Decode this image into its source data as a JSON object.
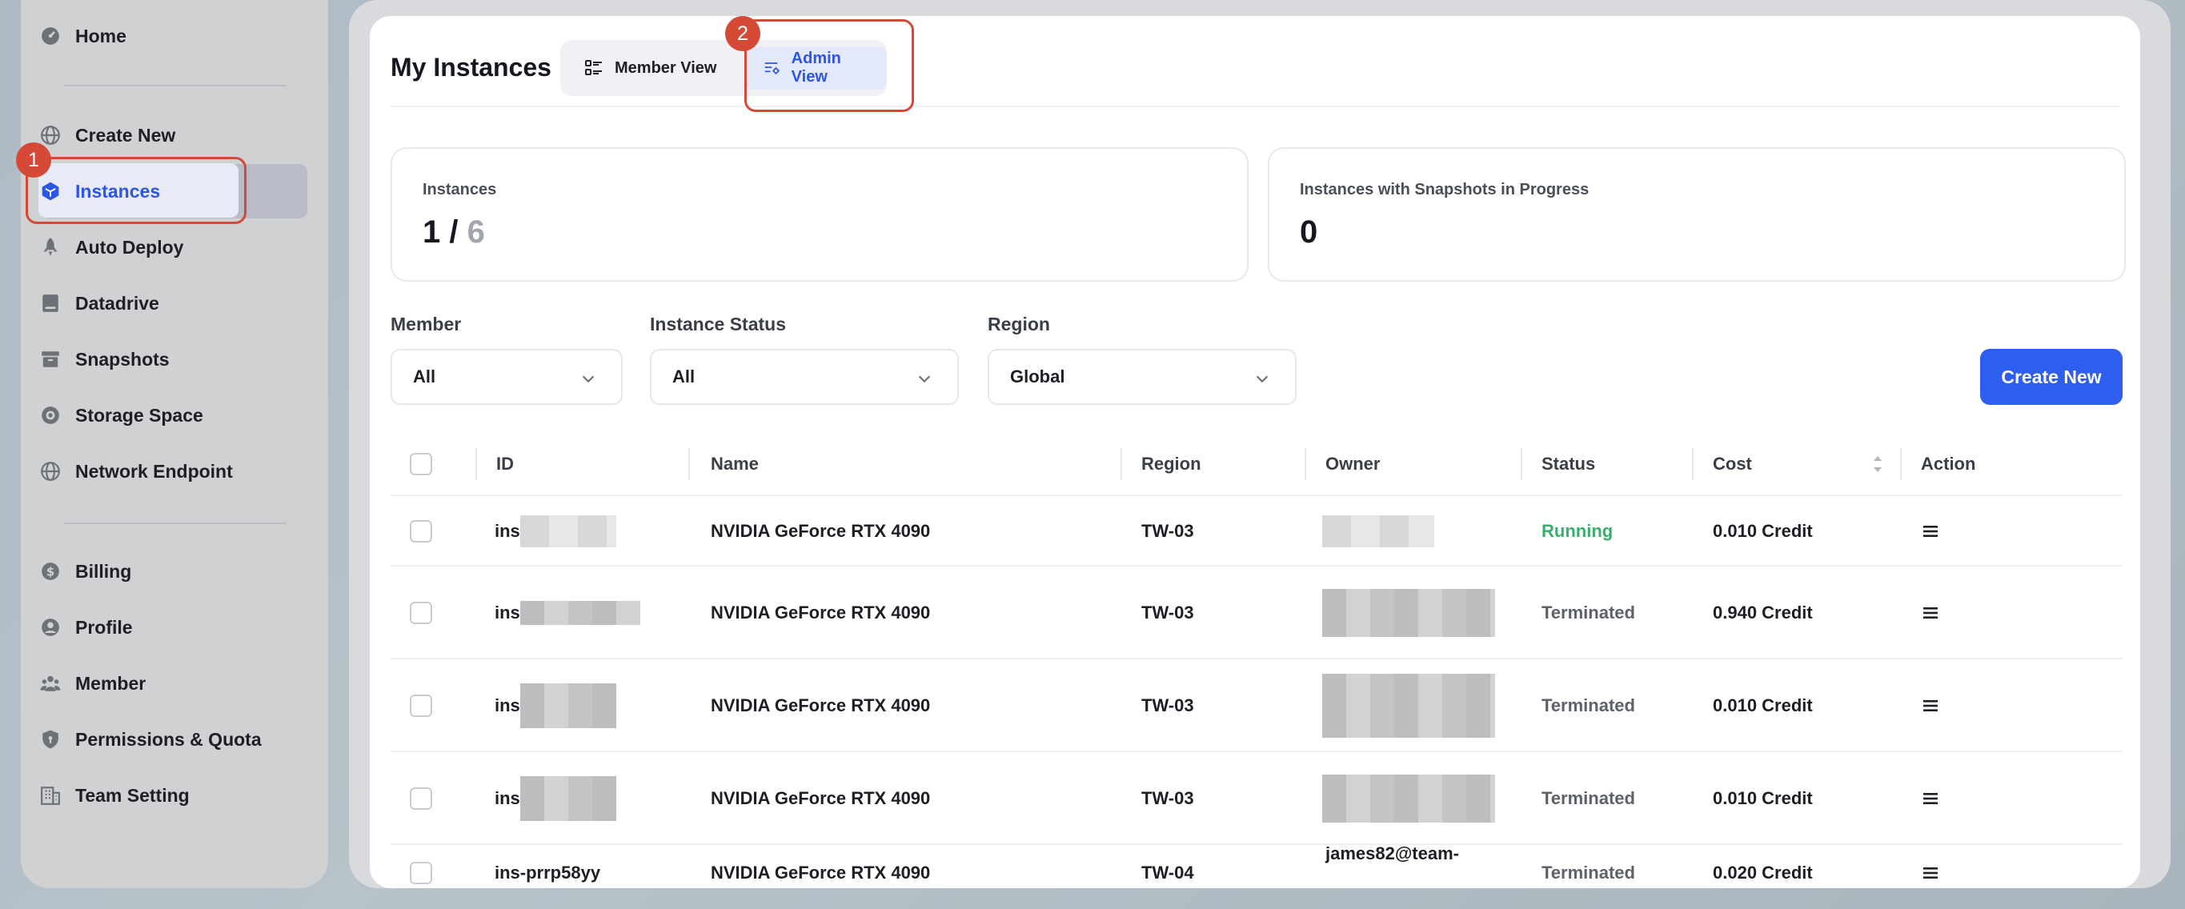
{
  "sidebar": {
    "items": [
      {
        "label": "Home",
        "icon": "dashboard-gauge-icon"
      },
      {
        "label": "Create New",
        "icon": "globe-icon"
      },
      {
        "label": "Instances",
        "icon": "cube-icon",
        "active": true
      },
      {
        "label": "Auto Deploy",
        "icon": "rocket-icon"
      },
      {
        "label": "Datadrive",
        "icon": "drive-icon"
      },
      {
        "label": "Snapshots",
        "icon": "archive-box-icon"
      },
      {
        "label": "Storage Space",
        "icon": "storage-disk-icon"
      },
      {
        "label": "Network Endpoint",
        "icon": "network-globe-icon"
      },
      {
        "label": "Billing",
        "icon": "coin-icon"
      },
      {
        "label": "Profile",
        "icon": "user-circle-icon"
      },
      {
        "label": "Member",
        "icon": "users-icon"
      },
      {
        "label": "Permissions & Quota",
        "icon": "shield-icon"
      },
      {
        "label": "Team Setting",
        "icon": "building-icon"
      }
    ]
  },
  "annotations": {
    "badge1": "1",
    "badge2": "2"
  },
  "header": {
    "title": "My Instances",
    "tabs": [
      {
        "label": "Member View",
        "icon": "list-icon"
      },
      {
        "label": "Admin View",
        "icon": "list-settings-icon",
        "selected": true
      }
    ]
  },
  "stats": [
    {
      "label": "Instances",
      "value": "1 /",
      "total": "6"
    },
    {
      "label": "Instances with Snapshots in Progress",
      "value": "0"
    }
  ],
  "filters": {
    "member": {
      "label": "Member",
      "value": "All"
    },
    "status": {
      "label": "Instance Status",
      "value": "All"
    },
    "region": {
      "label": "Region",
      "value": "Global"
    },
    "create_label": "Create New"
  },
  "table": {
    "columns": [
      "ID",
      "Name",
      "Region",
      "Owner",
      "Status",
      "Cost",
      "Action"
    ],
    "rows": [
      {
        "id": "ins",
        "name": "NVIDIA GeForce RTX 4090",
        "region": "TW-03",
        "owner": "",
        "status": "Running",
        "cost": "0.010 Credit"
      },
      {
        "id": "ins",
        "name": "NVIDIA GeForce RTX 4090",
        "region": "TW-03",
        "owner": "",
        "status": "Terminated",
        "cost": "0.940 Credit"
      },
      {
        "id": "ins",
        "name": "NVIDIA GeForce RTX 4090",
        "region": "TW-03",
        "owner": "",
        "status": "Terminated",
        "cost": "0.010 Credit"
      },
      {
        "id": "ins",
        "name": "NVIDIA GeForce RTX 4090",
        "region": "TW-03",
        "owner": "",
        "status": "Terminated",
        "cost": "0.010 Credit"
      },
      {
        "id": "ins-prrp58yy",
        "name": "NVIDIA GeForce RTX 4090",
        "region": "TW-04",
        "owner": "james82@team-",
        "status": "Terminated",
        "cost": "0.020 Credit"
      }
    ]
  },
  "colors": {
    "accent": "#2d5ef0",
    "running": "#3cae6c",
    "annotation": "#d44a37"
  }
}
